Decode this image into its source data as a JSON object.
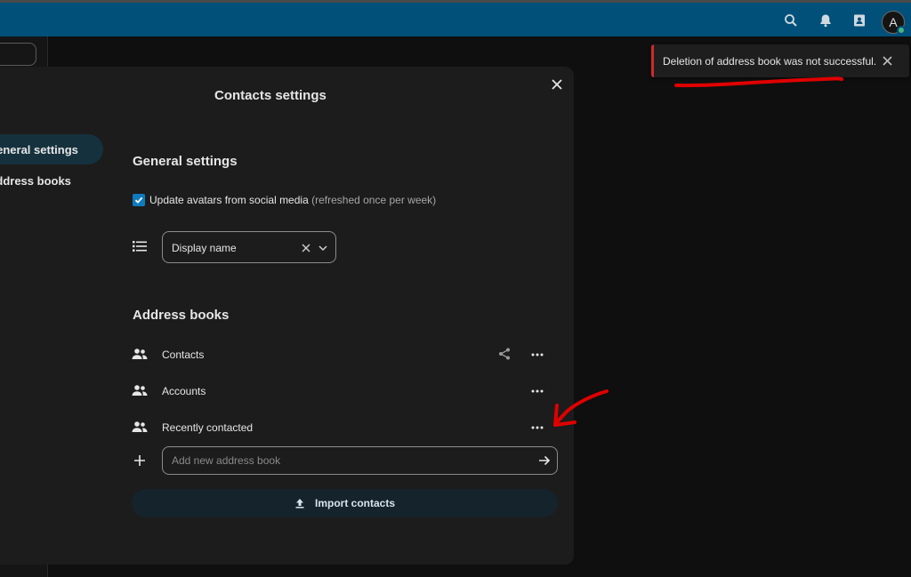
{
  "header": {
    "icons": [
      "search-icon",
      "bell-icon",
      "contacts-icon"
    ],
    "avatar_letter": "A",
    "color": "#00507a"
  },
  "toast": {
    "message": "Deletion of address book was not successful.",
    "accent": "#d12a2a"
  },
  "modal": {
    "title": "Contacts settings",
    "nav": [
      {
        "label": "General settings"
      },
      {
        "label": "Address books"
      }
    ]
  },
  "general": {
    "title": "General settings",
    "checkbox_label": "Update avatars from social media",
    "checkbox_hint": "(refreshed once per week)",
    "checkbox_checked": true,
    "sort_value": "Display name"
  },
  "address_books": {
    "title": "Address books",
    "items": [
      {
        "label": "Contacts",
        "shared": true
      },
      {
        "label": "Accounts",
        "shared": false
      },
      {
        "label": "Recently contacted",
        "shared": false
      }
    ],
    "add_placeholder": "Add new address book"
  },
  "import": {
    "label": "Import contacts"
  }
}
